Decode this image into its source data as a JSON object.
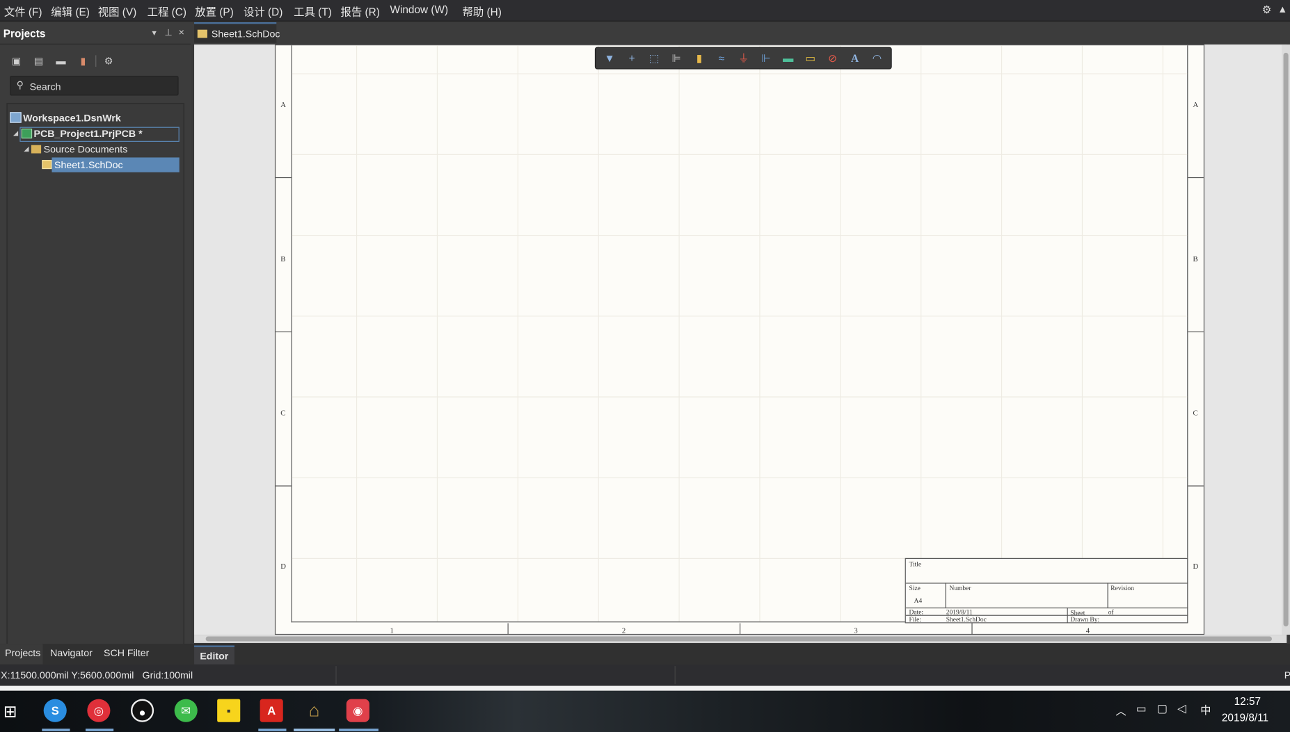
{
  "menu": [
    "文件 (F)",
    "编辑 (E)",
    "视图 (V)",
    "工程 (C)",
    "放置 (P)",
    "设计 (D)",
    "工具 (T)",
    "报告 (R)",
    "Window (W)",
    "帮助 (H)"
  ],
  "projects_panel": {
    "title": "Projects",
    "search_placeholder": "Search",
    "tree": {
      "workspace": "Workspace1.DsnWrk",
      "project": "PCB_Project1.PrjPCB *",
      "folder": "Source Documents",
      "document": "Sheet1.SchDoc"
    }
  },
  "document_tab": "Sheet1.SchDoc",
  "sheet": {
    "zone_rows": [
      "A",
      "B",
      "C",
      "D"
    ],
    "zone_columns": [
      "1",
      "2",
      "3",
      "4"
    ],
    "title_block": {
      "title_label": "Title",
      "size_label": "Size",
      "size_value": "A4",
      "number_label": "Number",
      "revision_label": "Revision",
      "date_label": "Date:",
      "date_value": "2019/8/11",
      "sheet_label": "Sheet",
      "of_label": "of",
      "file_label": "File:",
      "file_value": "Sheet1.SchDoc",
      "drawn_by_label": "Drawn By:"
    }
  },
  "active_bar_icons": [
    "filter-icon",
    "crosshair-icon",
    "select-area-icon",
    "align-icon",
    "part-icon",
    "wire-icon",
    "power-port-icon",
    "bus-icon",
    "sheet-symbol-icon",
    "port-icon",
    "no-erc-icon",
    "text-icon",
    "arc-icon"
  ],
  "bottom_tabs": [
    "Projects",
    "Navigator",
    "SCH Filter"
  ],
  "editor_tab": "Editor",
  "status": {
    "coords": "X:11500.000mil Y:5600.000mil",
    "grid": "Grid:100mil"
  },
  "taskbar": {
    "time": "12:57",
    "date": "2019/8/11",
    "ime": "中"
  },
  "colors": {
    "accent": "#4a6f99",
    "selection": "#5b87b5",
    "sheet": "#fdfcf8"
  }
}
